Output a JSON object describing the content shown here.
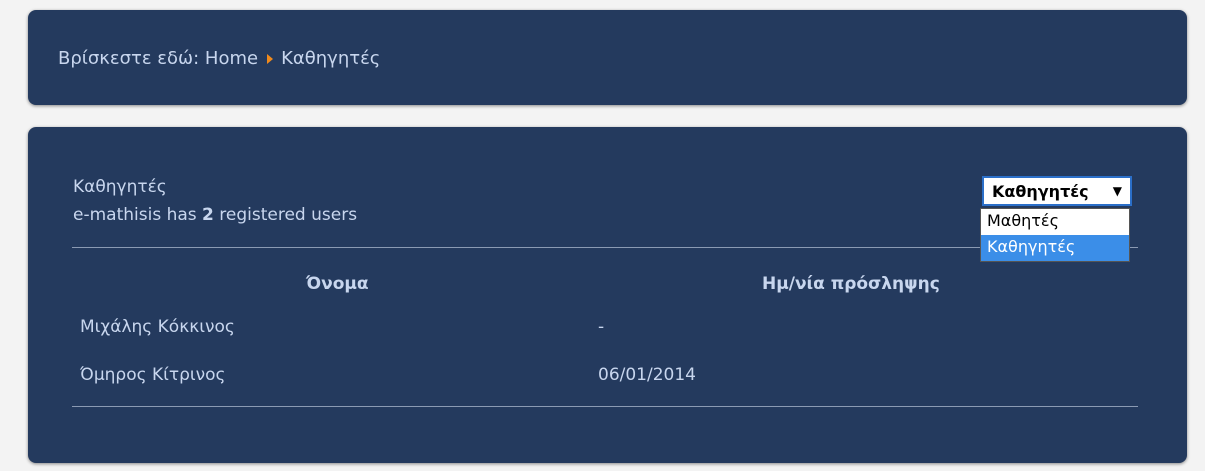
{
  "breadcrumb": {
    "prefix": "Βρίσκεστε εδώ:",
    "home": "Home",
    "current": "Καθηγητές"
  },
  "main": {
    "role_title": "Καθηγητές",
    "user_count_pre": "e-mathisis has ",
    "user_count_num": "2",
    "user_count_post": " registered users",
    "filter": {
      "selected": "Καθηγητές",
      "options": [
        "Μαθητές",
        "Καθηγητές"
      ]
    },
    "table": {
      "headers": [
        "Όνομα",
        "Ημ/νία πρόσληψης"
      ],
      "rows": [
        [
          "Μιχάλης Κόκκινος",
          "-"
        ],
        [
          "Όμηρος Κίτρινος",
          "06/01/2014"
        ]
      ]
    }
  },
  "colors": {
    "panel_bg": "#243a5e",
    "page_bg": "#f3f3f3",
    "accent": "#f08a1c",
    "selection": "#3b8ee8"
  }
}
